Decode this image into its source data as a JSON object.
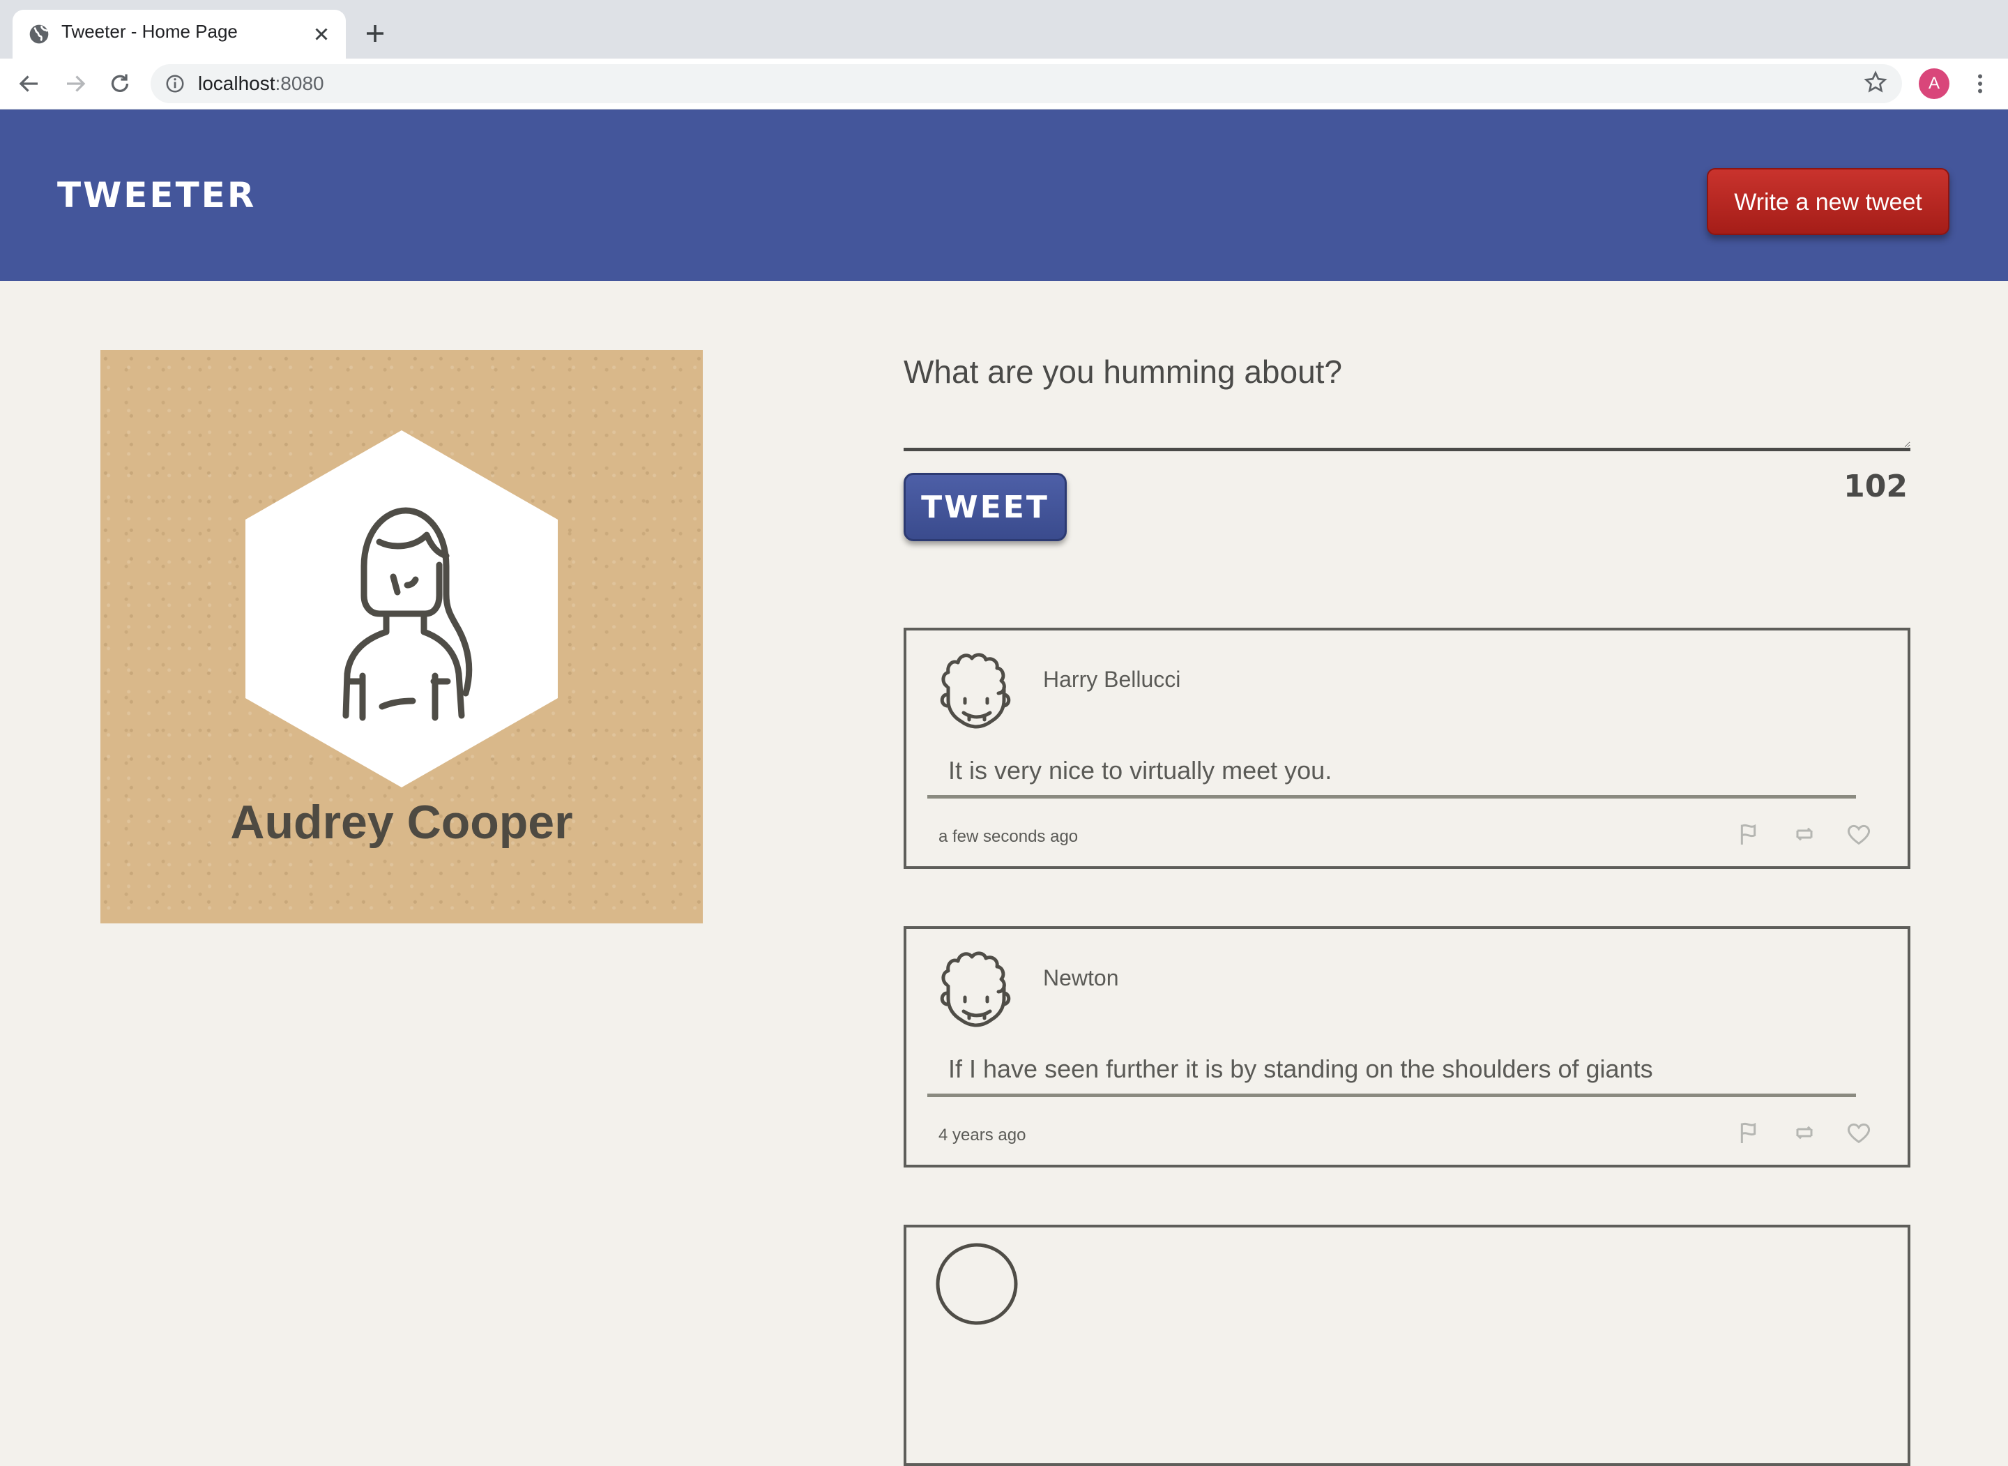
{
  "browser": {
    "tab_title": "Tweeter - Home Page",
    "url_host": "localhost",
    "url_port": ":8080",
    "profile_initial": "A"
  },
  "header": {
    "brand": "Tweeter",
    "compose_label": "Write a new tweet",
    "background": "#44569b",
    "compose_color": "#b8241f"
  },
  "profile": {
    "name": "Audrey Cooper"
  },
  "composer": {
    "prompt": "What are you humming about?",
    "button_label": "Tweet",
    "char_counter": "102"
  },
  "tweets": [
    {
      "author": "Harry Bellucci",
      "text": "It is very nice to virtually meet you.",
      "time": "a few seconds ago"
    },
    {
      "author": "Newton",
      "text": "If I have seen further it is by standing on the shoulders of giants",
      "time": "4 years ago"
    }
  ]
}
